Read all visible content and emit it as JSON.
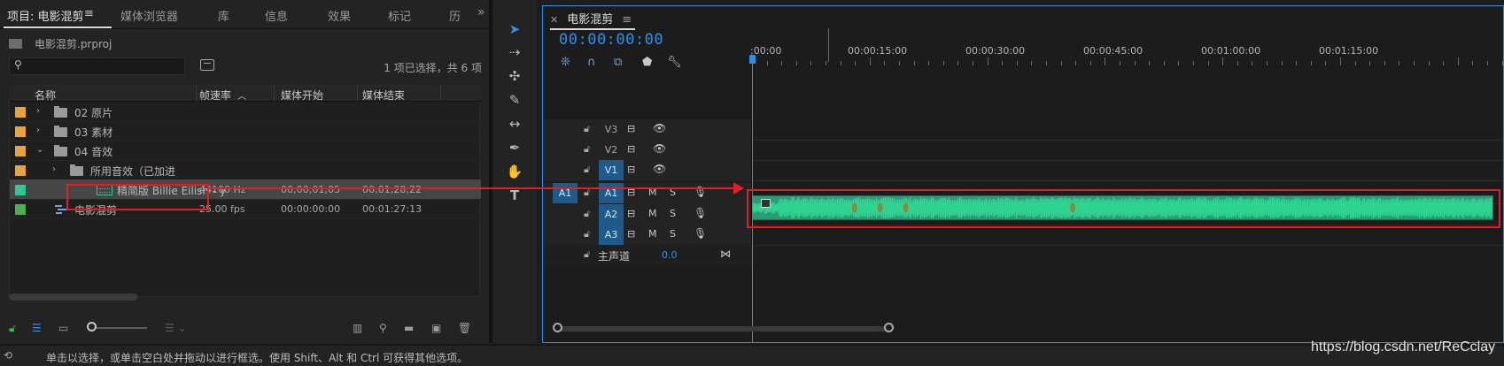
{
  "project_panel": {
    "tabs": [
      {
        "label": "项目: 电影混剪"
      },
      {
        "label": "媒体浏览器"
      },
      {
        "label": "库"
      },
      {
        "label": "信息"
      },
      {
        "label": "效果"
      },
      {
        "label": "标记"
      },
      {
        "label": "历"
      }
    ],
    "menu_icon": "≡",
    "more_icon": "»",
    "project_file": "电影混剪.prproj",
    "search": {
      "placeholder": "",
      "icon": "search-icon"
    },
    "selection_count": "1 项已选择，共 6 项",
    "columns": [
      "名称",
      "帧速率",
      "媒体开始",
      "媒体结束"
    ],
    "rows": [
      {
        "color": "#e8a33d",
        "name": "02 原片",
        "type": "folder",
        "indent": 0,
        "expanded": false,
        "framerate": "",
        "start": "",
        "end": ""
      },
      {
        "color": "#e8a33d",
        "name": "03 素材",
        "type": "folder",
        "indent": 0,
        "expanded": false,
        "framerate": "",
        "start": "",
        "end": ""
      },
      {
        "color": "#e8a33d",
        "name": "04 音效",
        "type": "folder",
        "indent": 0,
        "expanded": true,
        "framerate": "",
        "start": "",
        "end": ""
      },
      {
        "color": "#e8a33d",
        "name": "所用音效（已加进",
        "type": "folder",
        "indent": 1,
        "expanded": false,
        "framerate": "",
        "start": "",
        "end": ""
      },
      {
        "color": "#2fc793",
        "name": "精简版 Billie Eilish - y",
        "type": "audio",
        "indent": 2,
        "selected": true,
        "framerate": "44100 Hz",
        "start": "00;00;01;05",
        "end": "00;01;28;22"
      },
      {
        "color": "#4caf50",
        "name": "电影混剪",
        "type": "sequence",
        "indent": 0,
        "framerate": "25.00 fps",
        "start": "00:00:00:00",
        "end": "00:01:27:13"
      }
    ]
  },
  "timeline": {
    "tab_title": "电影混剪",
    "timecode": "00:00:00:00",
    "ruler_labels": [
      ":00:00",
      "00:00:15:00",
      "00:00:30:00",
      "00:00:45:00",
      "00:01:00:00",
      "00:01:15:00"
    ],
    "video_tracks": [
      "V3",
      "V2",
      "V1"
    ],
    "audio_tracks": [
      "A1",
      "A2",
      "A3"
    ],
    "source_patch": "A1",
    "master_label": "主声道",
    "master_value": "0.0",
    "clip_color": "#2c9b75"
  },
  "status_bar": {
    "text": "单击以选择，或单击空白处并拖动以进行框选。使用 Shift、Alt 和 Ctrl 可获得其他选项。"
  },
  "watermark": "https://blog.csdn.net/ReCclay"
}
